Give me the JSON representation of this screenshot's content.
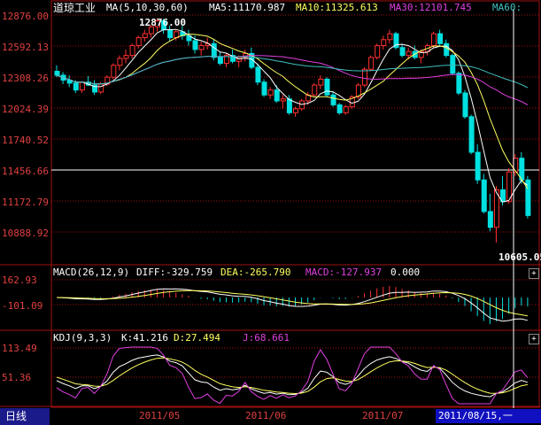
{
  "main_panel": {
    "title": "道琼工业",
    "ma_label": "MA(5,10,30,60)",
    "ma5_text": "MA5:11170.987",
    "ma10_text": "MA10:11325.613",
    "ma30_text": "MA30:12101.745",
    "ma60_text": "MA60:",
    "high_marker": "12876.00",
    "low_marker": "10605.05",
    "price_axis": [
      "12876.00",
      "12592.13",
      "12308.26",
      "12024.39",
      "11740.52",
      "11456.66",
      "11172.79",
      "10888.92"
    ]
  },
  "macd_panel": {
    "title": "MACD(26,12,9)",
    "diff_text": "DIFF:-329.759",
    "dea_text": "DEA:-265.790",
    "macd_text": "MACD:-127.937",
    "zero_text": "0.000",
    "axis": [
      "162.93",
      "-101.09"
    ]
  },
  "kdj_panel": {
    "title": "KDJ(9,3,3)",
    "k_text": "K:41.216",
    "d_text": "D:27.494",
    "j_text": "J:68.661",
    "axis": [
      "113.49",
      "51.36"
    ]
  },
  "bottom": {
    "period_tab": "日线",
    "dates": [
      "2011/05",
      "2011/06",
      "2011/07"
    ],
    "cursor_date": "2011/08/15,一"
  },
  "colors": {
    "up": "#ff3030",
    "down": "#00e0e0",
    "ma5": "#ffffff",
    "ma10": "#ffff60",
    "ma30": "#e040e0",
    "ma60": "#40c0c0",
    "grid": "#a01010",
    "axis_text": "#e04040"
  },
  "chart_data": {
    "type": "candlestick",
    "series_name": "道琼工业",
    "price_range": [
      10605.05,
      12876.0
    ],
    "ohlc": [
      [
        12340,
        12400,
        12280,
        12300
      ],
      [
        12300,
        12330,
        12210,
        12250
      ],
      [
        12250,
        12300,
        12180,
        12220
      ],
      [
        12220,
        12250,
        12120,
        12150
      ],
      [
        12150,
        12240,
        12120,
        12230
      ],
      [
        12230,
        12290,
        12190,
        12200
      ],
      [
        12200,
        12250,
        12100,
        12130
      ],
      [
        12130,
        12230,
        12110,
        12210
      ],
      [
        12210,
        12300,
        12190,
        12280
      ],
      [
        12280,
        12420,
        12260,
        12400
      ],
      [
        12400,
        12500,
        12350,
        12470
      ],
      [
        12470,
        12560,
        12420,
        12500
      ],
      [
        12500,
        12620,
        12470,
        12600
      ],
      [
        12600,
        12700,
        12570,
        12680
      ],
      [
        12680,
        12760,
        12640,
        12720
      ],
      [
        12720,
        12810,
        12680,
        12790
      ],
      [
        12790,
        12876,
        12740,
        12850
      ],
      [
        12850,
        12870,
        12720,
        12760
      ],
      [
        12760,
        12800,
        12640,
        12680
      ],
      [
        12680,
        12760,
        12650,
        12740
      ],
      [
        12740,
        12800,
        12660,
        12700
      ],
      [
        12700,
        12760,
        12600,
        12650
      ],
      [
        12650,
        12700,
        12520,
        12560
      ],
      [
        12560,
        12640,
        12500,
        12600
      ],
      [
        12600,
        12680,
        12560,
        12620
      ],
      [
        12620,
        12660,
        12450,
        12480
      ],
      [
        12480,
        12540,
        12400,
        12420
      ],
      [
        12420,
        12520,
        12380,
        12500
      ],
      [
        12500,
        12560,
        12420,
        12440
      ],
      [
        12440,
        12500,
        12380,
        12480
      ],
      [
        12480,
        12560,
        12440,
        12520
      ],
      [
        12520,
        12580,
        12360,
        12380
      ],
      [
        12380,
        12420,
        12200,
        12230
      ],
      [
        12230,
        12260,
        12080,
        12100
      ],
      [
        12100,
        12180,
        12060,
        12150
      ],
      [
        12150,
        12200,
        12020,
        12040
      ],
      [
        12040,
        12100,
        11960,
        12060
      ],
      [
        12060,
        12100,
        11900,
        11920
      ],
      [
        11920,
        11980,
        11880,
        11960
      ],
      [
        11960,
        12060,
        11940,
        12040
      ],
      [
        12040,
        12130,
        12000,
        12100
      ],
      [
        12100,
        12220,
        12080,
        12200
      ],
      [
        12200,
        12300,
        12160,
        12260
      ],
      [
        12260,
        12280,
        12080,
        12100
      ],
      [
        12100,
        12140,
        11980,
        12000
      ],
      [
        12000,
        12020,
        11900,
        11920
      ],
      [
        11920,
        12000,
        11900,
        11980
      ],
      [
        11980,
        12100,
        11960,
        12080
      ],
      [
        12080,
        12220,
        12060,
        12200
      ],
      [
        12200,
        12380,
        12180,
        12360
      ],
      [
        12360,
        12500,
        12340,
        12480
      ],
      [
        12480,
        12620,
        12460,
        12600
      ],
      [
        12600,
        12700,
        12560,
        12660
      ],
      [
        12660,
        12760,
        12620,
        12720
      ],
      [
        12720,
        12740,
        12560,
        12580
      ],
      [
        12580,
        12620,
        12480,
        12500
      ],
      [
        12500,
        12580,
        12460,
        12540
      ],
      [
        12540,
        12600,
        12460,
        12480
      ],
      [
        12480,
        12560,
        12420,
        12540
      ],
      [
        12540,
        12620,
        12500,
        12600
      ],
      [
        12600,
        12740,
        12580,
        12720
      ],
      [
        12720,
        12760,
        12600,
        12620
      ],
      [
        12620,
        12660,
        12480,
        12500
      ],
      [
        12500,
        12520,
        12300,
        12320
      ],
      [
        12320,
        12340,
        12100,
        12120
      ],
      [
        12120,
        12150,
        11860,
        11880
      ],
      [
        11880,
        11900,
        11500,
        11520
      ],
      [
        11520,
        11600,
        11200,
        11240
      ],
      [
        11240,
        11300,
        10900,
        10920
      ],
      [
        10920,
        11100,
        10720,
        10760
      ],
      [
        10760,
        11180,
        10605,
        11140
      ],
      [
        11140,
        11280,
        10980,
        11020
      ],
      [
        11020,
        11360,
        11000,
        11320
      ],
      [
        11320,
        11500,
        11280,
        11460
      ],
      [
        11460,
        11520,
        11200,
        11240
      ],
      [
        11240,
        11280,
        10850,
        10880
      ]
    ],
    "macd": {
      "diff": -329.759,
      "dea": -265.79,
      "macd": -127.937,
      "range": [
        -101.09,
        162.93
      ]
    },
    "kdj": {
      "k": 41.216,
      "d": 27.494,
      "j": 68.661,
      "range": [
        51.36,
        113.49
      ]
    }
  }
}
